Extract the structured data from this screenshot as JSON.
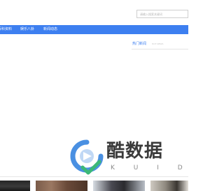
{
  "search": {
    "placeholder": "请输入搜索关键词"
  },
  "nav": {
    "items": [
      {
        "label": "百科资料"
      },
      {
        "label": "娱乐八卦"
      },
      {
        "label": "新闻动态"
      }
    ]
  },
  "hot_news": {
    "title": "热门新闻",
    "subtitle": "HOT NEWS"
  },
  "watermark": {
    "text": "酷数据",
    "letters": "K U I D C"
  },
  "colors": {
    "nav_bg": "#3d7ff0",
    "accent": "#3d7ff0",
    "watermark_blue": "#4a90e2",
    "watermark_green": "#3cb878"
  }
}
